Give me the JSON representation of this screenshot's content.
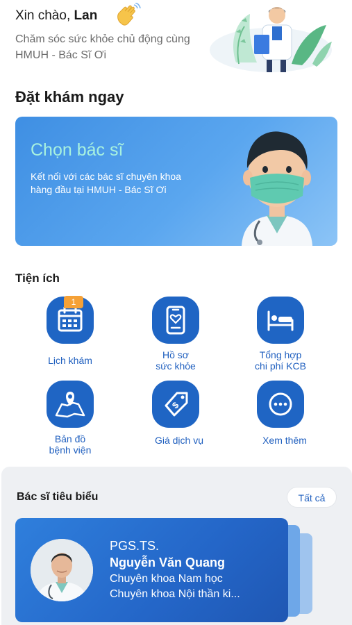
{
  "header": {
    "greeting": "Xin chào,",
    "user_name": "Lan",
    "subtitle": "Chăm sóc sức khỏe chủ động cùng HMUH - Bác Sĩ Ơi"
  },
  "booking": {
    "section_title": "Đặt khám ngay",
    "banner_title": "Chọn bác sĩ",
    "banner_desc": "Kết nối với các bác sĩ chuyên khoa hàng đầu tại HMUH - Bác Sĩ Ơi"
  },
  "utilities": {
    "section_title": "Tiện ích",
    "items": [
      {
        "label_1": "Lịch khám",
        "label_2": "",
        "icon": "calendar-icon",
        "badge": "1"
      },
      {
        "label_1": "Hồ sơ",
        "label_2": "sức khỏe",
        "icon": "health-record-icon"
      },
      {
        "label_1": "Tổng hợp",
        "label_2": "chi phí KCB",
        "icon": "hospital-bed-icon"
      },
      {
        "label_1": "Bản đồ",
        "label_2": "bệnh viện",
        "icon": "map-icon"
      },
      {
        "label_1": "Giá dịch vụ",
        "label_2": "",
        "icon": "price-tag-icon"
      },
      {
        "label_1": "Xem thêm",
        "label_2": "",
        "icon": "more-icon"
      }
    ]
  },
  "featured": {
    "section_title": "Bác sĩ tiêu biểu",
    "see_all": "Tất cả",
    "doctor": {
      "title": "PGS.TS.",
      "name": "Nguyễn Văn Quang",
      "specialty_1": "Chuyên khoa Nam học",
      "specialty_2": "Chuyên khoa Nội thần ki..."
    }
  },
  "colors": {
    "primary": "#1f65c4",
    "banner_title": "#a7f1df",
    "badge": "#f5a137"
  }
}
